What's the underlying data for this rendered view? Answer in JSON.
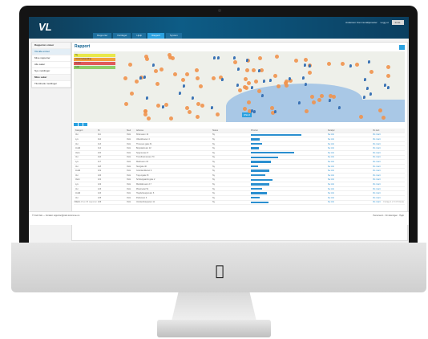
{
  "app": {
    "brand": "VL",
    "badge": "OSLO"
  },
  "nav": {
    "tabs": [
      "Rapporter",
      "Kartlaget",
      "Hjelp",
      "Rapport",
      "System"
    ],
    "user_name": "Andersen Kommunaltjenester",
    "logout": "Logg ut",
    "settings": "Innst."
  },
  "sidebar": {
    "items": [
      "Rapporter emner",
      "Vis alle emner",
      "Mine rapporter",
      "Alle saker",
      "Nye meldinger",
      "Mine saker",
      "Tilordnede meldinger"
    ]
  },
  "page": {
    "title": "Rapport"
  },
  "legend": [
    {
      "label": "Ny",
      "color": "#e8e84a"
    },
    {
      "label": "Under behandling",
      "color": "#f3a03d"
    },
    {
      "label": "Avvist",
      "color": "#e05a5a"
    },
    {
      "label": "Løst",
      "color": "#8fcf6a"
    }
  ],
  "table": {
    "headers": [
      "Kategori",
      "Nr",
      "Sted",
      "Adresse",
      "Status",
      "Prioritet",
      "Detaljer",
      "Vis kart"
    ],
    "rows": [
      {
        "cat": "Vei",
        "num": "111",
        "place": "Oslo",
        "addr": "Kirkeveien 12",
        "status": "Ny",
        "bar": 0.7,
        "link": "Se info",
        "map": "Vis i kart"
      },
      {
        "cat": "Lys",
        "num": "112",
        "place": "Oslo",
        "addr": "Ullevålsveien 4",
        "status": "Ny",
        "bar": 0.12,
        "link": "Se info",
        "map": "Vis i kart"
      },
      {
        "cat": "Vei",
        "num": "113",
        "place": "Oslo",
        "addr": "Thereses gate 31",
        "status": "Ny",
        "bar": 0.15,
        "link": "Se info",
        "map": "Vis i kart"
      },
      {
        "cat": "Avfall",
        "num": "114",
        "place": "Oslo",
        "addr": "Bogstadveien 22",
        "status": "Ny",
        "bar": 0.11,
        "link": "Se info",
        "map": "Vis i kart"
      },
      {
        "cat": "Vann",
        "num": "115",
        "place": "Oslo",
        "addr": "Sognsveien 8",
        "status": "Ny",
        "bar": 0.6,
        "link": "Se info",
        "map": "Vis i kart"
      },
      {
        "cat": "Vei",
        "num": "116",
        "place": "Oslo",
        "addr": "Trondheimsveien 70",
        "status": "Ny",
        "bar": 0.38,
        "link": "Se info",
        "map": "Vis i kart"
      },
      {
        "cat": "Lys",
        "num": "117",
        "place": "Oslo",
        "addr": "Markveien 15",
        "status": "Ny",
        "bar": 0.28,
        "link": "Se info",
        "map": "Vis i kart"
      },
      {
        "cat": "Vei",
        "num": "118",
        "place": "Oslo",
        "addr": "Storgata 40",
        "status": "Ny",
        "bar": 0.1,
        "link": "Se info",
        "map": "Vis i kart"
      },
      {
        "cat": "Avfall",
        "num": "119",
        "place": "Oslo",
        "addr": "Grønlandsleiret 9",
        "status": "Ny",
        "bar": 0.25,
        "link": "Se info",
        "map": "Vis i kart"
      },
      {
        "cat": "Vei",
        "num": "120",
        "place": "Oslo",
        "addr": "Tøyengata 33",
        "status": "Ny",
        "bar": 0.2,
        "link": "Se info",
        "map": "Vis i kart"
      },
      {
        "cat": "Vann",
        "num": "121",
        "place": "Oslo",
        "addr": "Schweigaards gate 2",
        "status": "Ny",
        "bar": 0.3,
        "link": "Se info",
        "map": "Vis i kart"
      },
      {
        "cat": "Lys",
        "num": "122",
        "place": "Oslo",
        "addr": "Maridalsveien 17",
        "status": "Ny",
        "bar": 0.25,
        "link": "Se info",
        "map": "Vis i kart"
      },
      {
        "cat": "Vei",
        "num": "123",
        "place": "Oslo",
        "addr": "Pilestredet 51",
        "status": "Ny",
        "bar": 0.15,
        "link": "Se info",
        "map": "Vis i kart"
      },
      {
        "cat": "Avfall",
        "num": "124",
        "place": "Oslo",
        "addr": "Hegdehaugsveien 6",
        "status": "Ny",
        "bar": 0.22,
        "link": "Se info",
        "map": "Vis i kart"
      },
      {
        "cat": "Vei",
        "num": "125",
        "place": "Oslo",
        "addr": "Parkveien 3",
        "status": "Ny",
        "bar": 0.12,
        "link": "Se info",
        "map": "Vis i kart"
      },
      {
        "cat": "Vann",
        "num": "126",
        "place": "Oslo",
        "addr": "Uranienborgveien 11",
        "status": "Ny",
        "bar": 0.24,
        "link": "Se info",
        "map": "Vis i kart"
      }
    ],
    "pager_left": "Viser 1-16 av 65 rapporter",
    "pager_right": "Forrige 1 2 3 4 5 Neste"
  },
  "footer": {
    "left": "© Visit Oslo — Kontakt: rapporter@oslo.kommune.no",
    "right": "Personvern · Om løsningen · Hjelp"
  }
}
